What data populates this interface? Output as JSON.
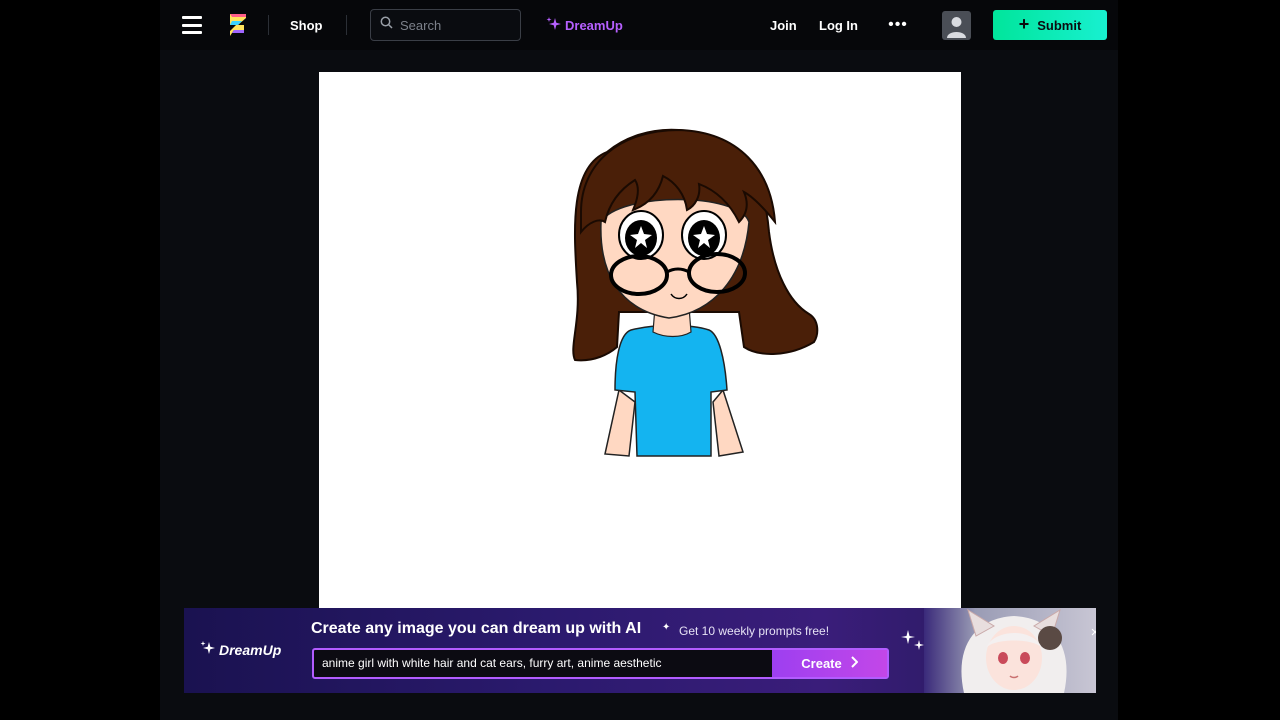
{
  "topbar": {
    "shop_label": "Shop",
    "search_placeholder": "Search",
    "dreamup_label": "DreamUp",
    "join_label": "Join",
    "login_label": "Log In",
    "more_label": "•••",
    "submit_label": "Submit"
  },
  "banner": {
    "logo_label": "DreamUp",
    "headline": "Create any image you can dream up with AI",
    "subtext": "Get 10 weekly prompts free!",
    "prompt_value": "anime girl with white hair and cat ears, furry art, anime aesthetic",
    "create_label": "Create"
  },
  "icons": {
    "menu": "menu-icon",
    "logo": "deviantart-logo-icon",
    "search": "search-icon",
    "sparkle": "sparkle-icon",
    "more": "more-icon",
    "avatar": "user-avatar-icon",
    "plus": "plus-icon",
    "chevron": "chevron-right-icon",
    "close": "close-icon"
  },
  "colors": {
    "background": "#000000",
    "app_background": "#0a0c10",
    "submit_button": "#00e59b",
    "dreamup_accent": "#b660ff",
    "create_button": "#b347ea",
    "banner_background": "#2b1a6e"
  }
}
